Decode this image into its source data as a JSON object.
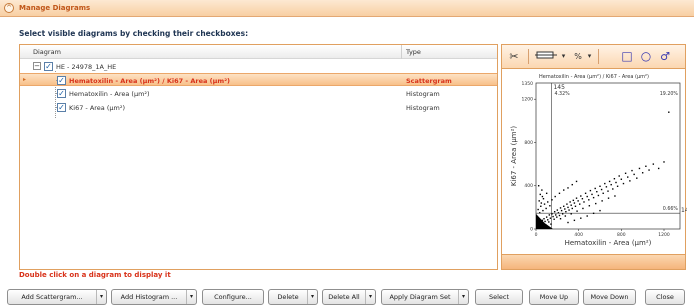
{
  "window": {
    "title": "Manage Diagrams"
  },
  "heading": "Select visible diagrams by checking their checkboxes:",
  "grid": {
    "columns": {
      "diagram": "Diagram",
      "type": "Type"
    },
    "group": {
      "label": "HE - 24978_1A_HE",
      "checked": true
    },
    "rows": [
      {
        "label": "Hematoxilin - Area (µm²) / Ki67 - Area (µm²)",
        "type": "Scattergram",
        "checked": true,
        "selected": true
      },
      {
        "label": "Hematoxilin - Area (µm²)",
        "type": "Histogram",
        "checked": true,
        "selected": false
      },
      {
        "label": "Ki67 - Area (µm²)",
        "type": "Histogram",
        "checked": true,
        "selected": false
      }
    ]
  },
  "hint": "Double click on a diagram to display it",
  "preview": {
    "toolbar": {
      "cut_icon": "scissors-icon",
      "range_icon": "range-icon",
      "percent_label": "%",
      "rect_icon": "rectangle-select-icon",
      "ellipse_icon": "ellipse-select-icon",
      "lasso_icon": "lasso-select-icon"
    }
  },
  "chart_data": {
    "type": "scatter",
    "title": "Hematoxilin - Area (µm²) / Ki67 - Area (µm²)",
    "xlabel": "Hematoxilin - Area (µm²)",
    "ylabel": "Ki67 - Area (µm²)",
    "xlim": [
      0,
      1350
    ],
    "ylim": [
      0,
      1350
    ],
    "xticks": [
      "0",
      "400",
      "800",
      "1200"
    ],
    "yticks": [
      "0",
      "400",
      "800",
      "1200"
    ],
    "ytick_top": "1350",
    "threshold_x_label": "145",
    "threshold_y_label": "146",
    "quadrant_labels": {
      "top_left": "4.32%",
      "top_right": "19.20%",
      "bottom_right": "0.66%"
    },
    "grid": false,
    "colors": {
      "points": "#000000",
      "accent": "#d8321a"
    },
    "points": [
      [
        12,
        20
      ],
      [
        18,
        35
      ],
      [
        25,
        15
      ],
      [
        30,
        50
      ],
      [
        40,
        28
      ],
      [
        45,
        60
      ],
      [
        55,
        42
      ],
      [
        60,
        80
      ],
      [
        70,
        55
      ],
      [
        75,
        95
      ],
      [
        85,
        70
      ],
      [
        90,
        40
      ],
      [
        100,
        110
      ],
      [
        110,
        85
      ],
      [
        120,
        65
      ],
      [
        125,
        130
      ],
      [
        135,
        100
      ],
      [
        140,
        45
      ],
      [
        150,
        140
      ],
      [
        160,
        115
      ],
      [
        170,
        90
      ],
      [
        175,
        160
      ],
      [
        185,
        130
      ],
      [
        195,
        110
      ],
      [
        200,
        175
      ],
      [
        210,
        150
      ],
      [
        220,
        125
      ],
      [
        230,
        195
      ],
      [
        240,
        170
      ],
      [
        250,
        140
      ],
      [
        260,
        210
      ],
      [
        270,
        185
      ],
      [
        280,
        160
      ],
      [
        290,
        230
      ],
      [
        300,
        200
      ],
      [
        310,
        175
      ],
      [
        320,
        250
      ],
      [
        330,
        220
      ],
      [
        340,
        190
      ],
      [
        350,
        265
      ],
      [
        360,
        240
      ],
      [
        370,
        210
      ],
      [
        380,
        285
      ],
      [
        395,
        260
      ],
      [
        410,
        230
      ],
      [
        420,
        305
      ],
      [
        435,
        280
      ],
      [
        450,
        250
      ],
      [
        465,
        330
      ],
      [
        480,
        300
      ],
      [
        495,
        270
      ],
      [
        510,
        355
      ],
      [
        525,
        320
      ],
      [
        540,
        290
      ],
      [
        555,
        375
      ],
      [
        570,
        345
      ],
      [
        585,
        310
      ],
      [
        600,
        395
      ],
      [
        615,
        365
      ],
      [
        630,
        330
      ],
      [
        645,
        420
      ],
      [
        660,
        390
      ],
      [
        675,
        350
      ],
      [
        690,
        440
      ],
      [
        705,
        410
      ],
      [
        720,
        370
      ],
      [
        735,
        465
      ],
      [
        750,
        430
      ],
      [
        765,
        395
      ],
      [
        780,
        490
      ],
      [
        800,
        460
      ],
      [
        820,
        420
      ],
      [
        840,
        515
      ],
      [
        860,
        480
      ],
      [
        880,
        445
      ],
      [
        900,
        540
      ],
      [
        920,
        505
      ],
      [
        945,
        470
      ],
      [
        970,
        560
      ],
      [
        1000,
        520
      ],
      [
        1030,
        580
      ],
      [
        1060,
        545
      ],
      [
        1100,
        600
      ],
      [
        1150,
        560
      ],
      [
        1200,
        620
      ],
      [
        1245,
        1080
      ],
      [
        20,
        180
      ],
      [
        30,
        260
      ],
      [
        40,
        320
      ],
      [
        25,
        400
      ],
      [
        50,
        240
      ],
      [
        60,
        300
      ],
      [
        35,
        150
      ],
      [
        15,
        90
      ],
      [
        45,
        210
      ],
      [
        65,
        170
      ],
      [
        80,
        230
      ],
      [
        95,
        190
      ],
      [
        70,
        280
      ],
      [
        110,
        250
      ],
      [
        130,
        215
      ],
      [
        55,
        360
      ],
      [
        100,
        330
      ],
      [
        150,
        270
      ],
      [
        180,
        300
      ],
      [
        220,
        330
      ],
      [
        260,
        360
      ],
      [
        300,
        380
      ],
      [
        340,
        410
      ],
      [
        380,
        440
      ],
      [
        230,
        95
      ],
      [
        275,
        120
      ],
      [
        330,
        140
      ],
      [
        385,
        165
      ],
      [
        440,
        190
      ],
      [
        500,
        215
      ],
      [
        560,
        235
      ],
      [
        620,
        260
      ],
      [
        680,
        285
      ],
      [
        740,
        305
      ],
      [
        300,
        60
      ],
      [
        360,
        80
      ],
      [
        420,
        100
      ],
      [
        480,
        120
      ],
      [
        540,
        145
      ],
      [
        600,
        170
      ]
    ],
    "dense_cluster": {
      "x_max": 160,
      "y_max": 140
    }
  }
}
